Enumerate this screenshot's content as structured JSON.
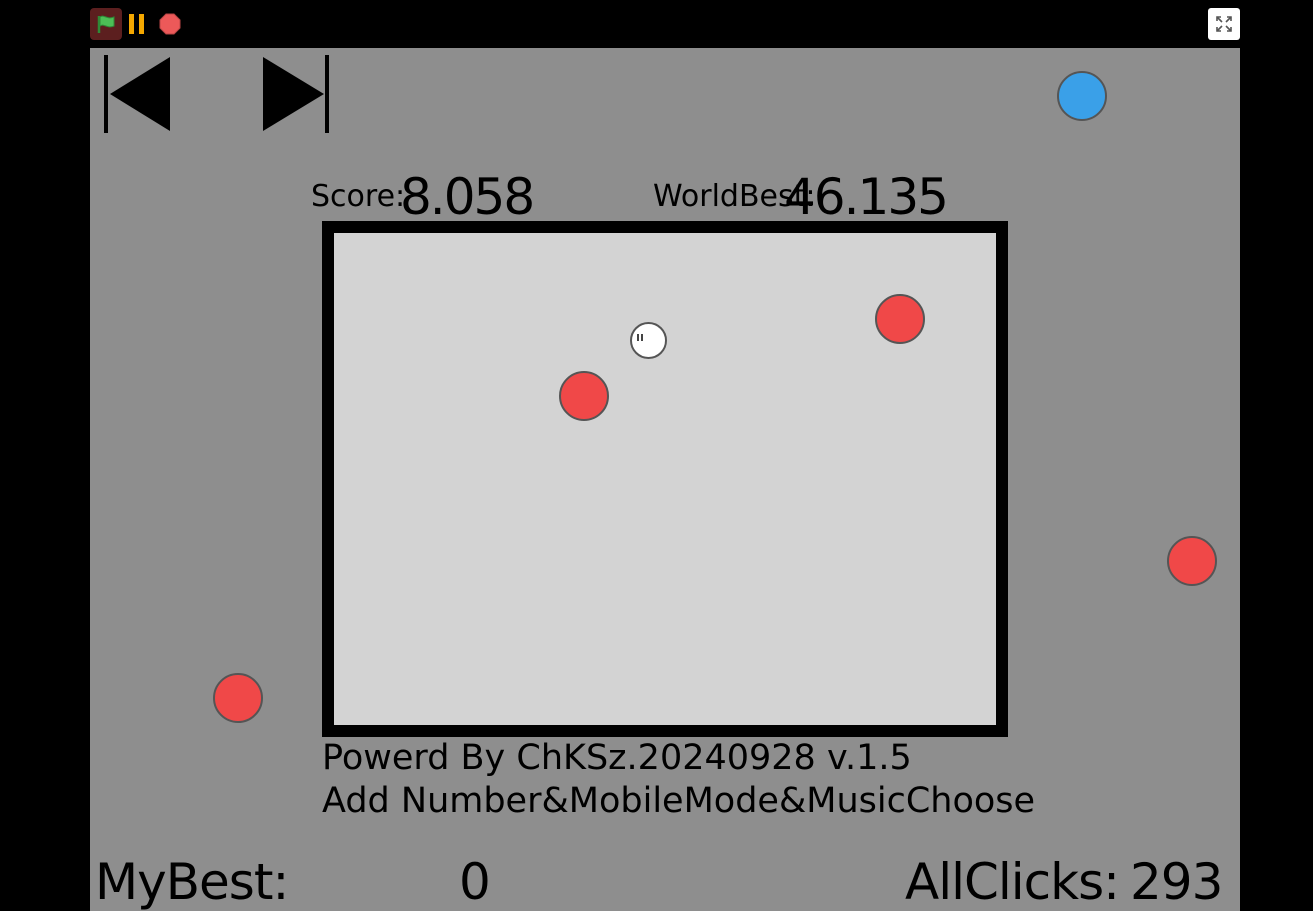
{
  "toolbar": {
    "green_flag_icon": "green-flag-icon",
    "pause_icon": "pause-icon",
    "stop_icon": "stop-icon",
    "fullscreen_icon": "fullscreen-icon"
  },
  "stage": {
    "score_label": "Score:",
    "score_value": "8.058",
    "world_best_label": "WorldBest:",
    "world_best_value": "46.135",
    "credit_line1": "Powerd By ChKSz.20240928  v.1.5",
    "credit_line2": "Add Number&MobileMode&MusicChoose",
    "my_best_label": "MyBest:",
    "my_best_value": "0",
    "all_clicks_label": "AllClicks:",
    "all_clicks_value": "293"
  },
  "colors": {
    "stage_bg": "#8e8e8e",
    "arena_bg": "#d3d3d3",
    "enemy": "#f04848",
    "blue_ball": "#3aa0e8",
    "flag_green": "#4cbf56",
    "pause_orange": "#f5a800",
    "stop_red": "#ec5959"
  }
}
